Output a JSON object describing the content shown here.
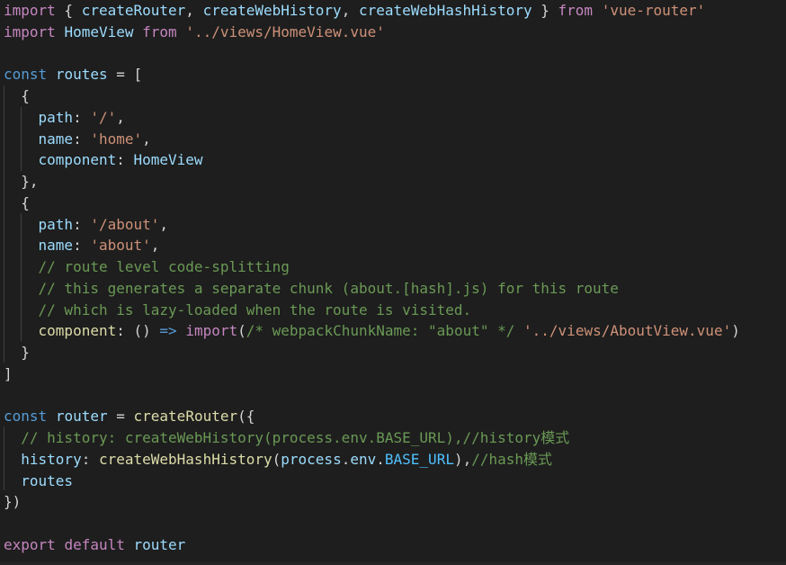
{
  "editor": {
    "theme": {
      "background": "#1e1e1e",
      "default": "#d4d4d4",
      "control": "#c586c0",
      "keyword": "#569cd6",
      "variable": "#9cdcfe",
      "function": "#dcdcaa",
      "string": "#ce9178",
      "comment": "#6a9955",
      "type": "#4ec9b0",
      "constant": "#4fc1ff",
      "indent_guide": "#404040"
    },
    "lines": [
      [
        [
          "ctrl",
          "import"
        ],
        [
          "pun",
          " { "
        ],
        [
          "var",
          "createRouter"
        ],
        [
          "pun",
          ", "
        ],
        [
          "var",
          "createWebHistory"
        ],
        [
          "pun",
          ", "
        ],
        [
          "var",
          "createWebHashHistory"
        ],
        [
          "pun",
          " } "
        ],
        [
          "ctrl",
          "from"
        ],
        [
          "pun",
          " "
        ],
        [
          "str",
          "'vue-router'"
        ]
      ],
      [
        [
          "ctrl",
          "import"
        ],
        [
          "pun",
          " "
        ],
        [
          "var",
          "HomeView"
        ],
        [
          "pun",
          " "
        ],
        [
          "ctrl",
          "from"
        ],
        [
          "pun",
          " "
        ],
        [
          "str",
          "'../views/HomeView.vue'"
        ]
      ],
      [],
      [
        [
          "kw",
          "const"
        ],
        [
          "pun",
          " "
        ],
        [
          "var",
          "routes"
        ],
        [
          "pun",
          " = ["
        ]
      ],
      [
        [
          "pun",
          "  {"
        ]
      ],
      [
        [
          "pun",
          "    "
        ],
        [
          "var",
          "path"
        ],
        [
          "pun",
          ": "
        ],
        [
          "str",
          "'/'"
        ],
        [
          "pun",
          ","
        ]
      ],
      [
        [
          "pun",
          "    "
        ],
        [
          "var",
          "name"
        ],
        [
          "pun",
          ": "
        ],
        [
          "str",
          "'home'"
        ],
        [
          "pun",
          ","
        ]
      ],
      [
        [
          "pun",
          "    "
        ],
        [
          "var",
          "component"
        ],
        [
          "pun",
          ": "
        ],
        [
          "var",
          "HomeView"
        ]
      ],
      [
        [
          "pun",
          "  },"
        ]
      ],
      [
        [
          "pun",
          "  {"
        ]
      ],
      [
        [
          "pun",
          "    "
        ],
        [
          "var",
          "path"
        ],
        [
          "pun",
          ": "
        ],
        [
          "str",
          "'/about'"
        ],
        [
          "pun",
          ","
        ]
      ],
      [
        [
          "pun",
          "    "
        ],
        [
          "var",
          "name"
        ],
        [
          "pun",
          ": "
        ],
        [
          "str",
          "'about'"
        ],
        [
          "pun",
          ","
        ]
      ],
      [
        [
          "pun",
          "    "
        ],
        [
          "com",
          "// route level code-splitting"
        ]
      ],
      [
        [
          "pun",
          "    "
        ],
        [
          "com",
          "// this generates a separate chunk (about.[hash].js) for this route"
        ]
      ],
      [
        [
          "pun",
          "    "
        ],
        [
          "com",
          "// which is lazy-loaded when the route is visited."
        ]
      ],
      [
        [
          "pun",
          "    "
        ],
        [
          "fn",
          "component"
        ],
        [
          "pun",
          ": () "
        ],
        [
          "kw",
          "=>"
        ],
        [
          "pun",
          " "
        ],
        [
          "ctrl",
          "import"
        ],
        [
          "pun",
          "("
        ],
        [
          "com",
          "/* webpackChunkName: \"about\" */"
        ],
        [
          "pun",
          " "
        ],
        [
          "str",
          "'../views/AboutView.vue'"
        ],
        [
          "pun",
          ")"
        ]
      ],
      [
        [
          "pun",
          "  }"
        ]
      ],
      [
        [
          "pun",
          "]"
        ]
      ],
      [],
      [
        [
          "kw",
          "const"
        ],
        [
          "pun",
          " "
        ],
        [
          "var",
          "router"
        ],
        [
          "pun",
          " = "
        ],
        [
          "fn",
          "createRouter"
        ],
        [
          "pun",
          "({"
        ]
      ],
      [
        [
          "pun",
          "  "
        ],
        [
          "com",
          "// history: createWebHistory(process.env.BASE_URL),//history模式"
        ]
      ],
      [
        [
          "pun",
          "  "
        ],
        [
          "var",
          "history"
        ],
        [
          "pun",
          ": "
        ],
        [
          "fn",
          "createWebHashHistory"
        ],
        [
          "pun",
          "("
        ],
        [
          "var",
          "process"
        ],
        [
          "pun",
          "."
        ],
        [
          "var",
          "env"
        ],
        [
          "pun",
          "."
        ],
        [
          "ent",
          "BASE_URL"
        ],
        [
          "pun",
          "),"
        ],
        [
          "com",
          "//hash模式"
        ]
      ],
      [
        [
          "pun",
          "  "
        ],
        [
          "var",
          "routes"
        ]
      ],
      [
        [
          "pun",
          "})"
        ]
      ],
      [],
      [
        [
          "ctrl",
          "export"
        ],
        [
          "pun",
          " "
        ],
        [
          "ctrl",
          "default"
        ],
        [
          "pun",
          " "
        ],
        [
          "var",
          "router"
        ]
      ]
    ]
  }
}
